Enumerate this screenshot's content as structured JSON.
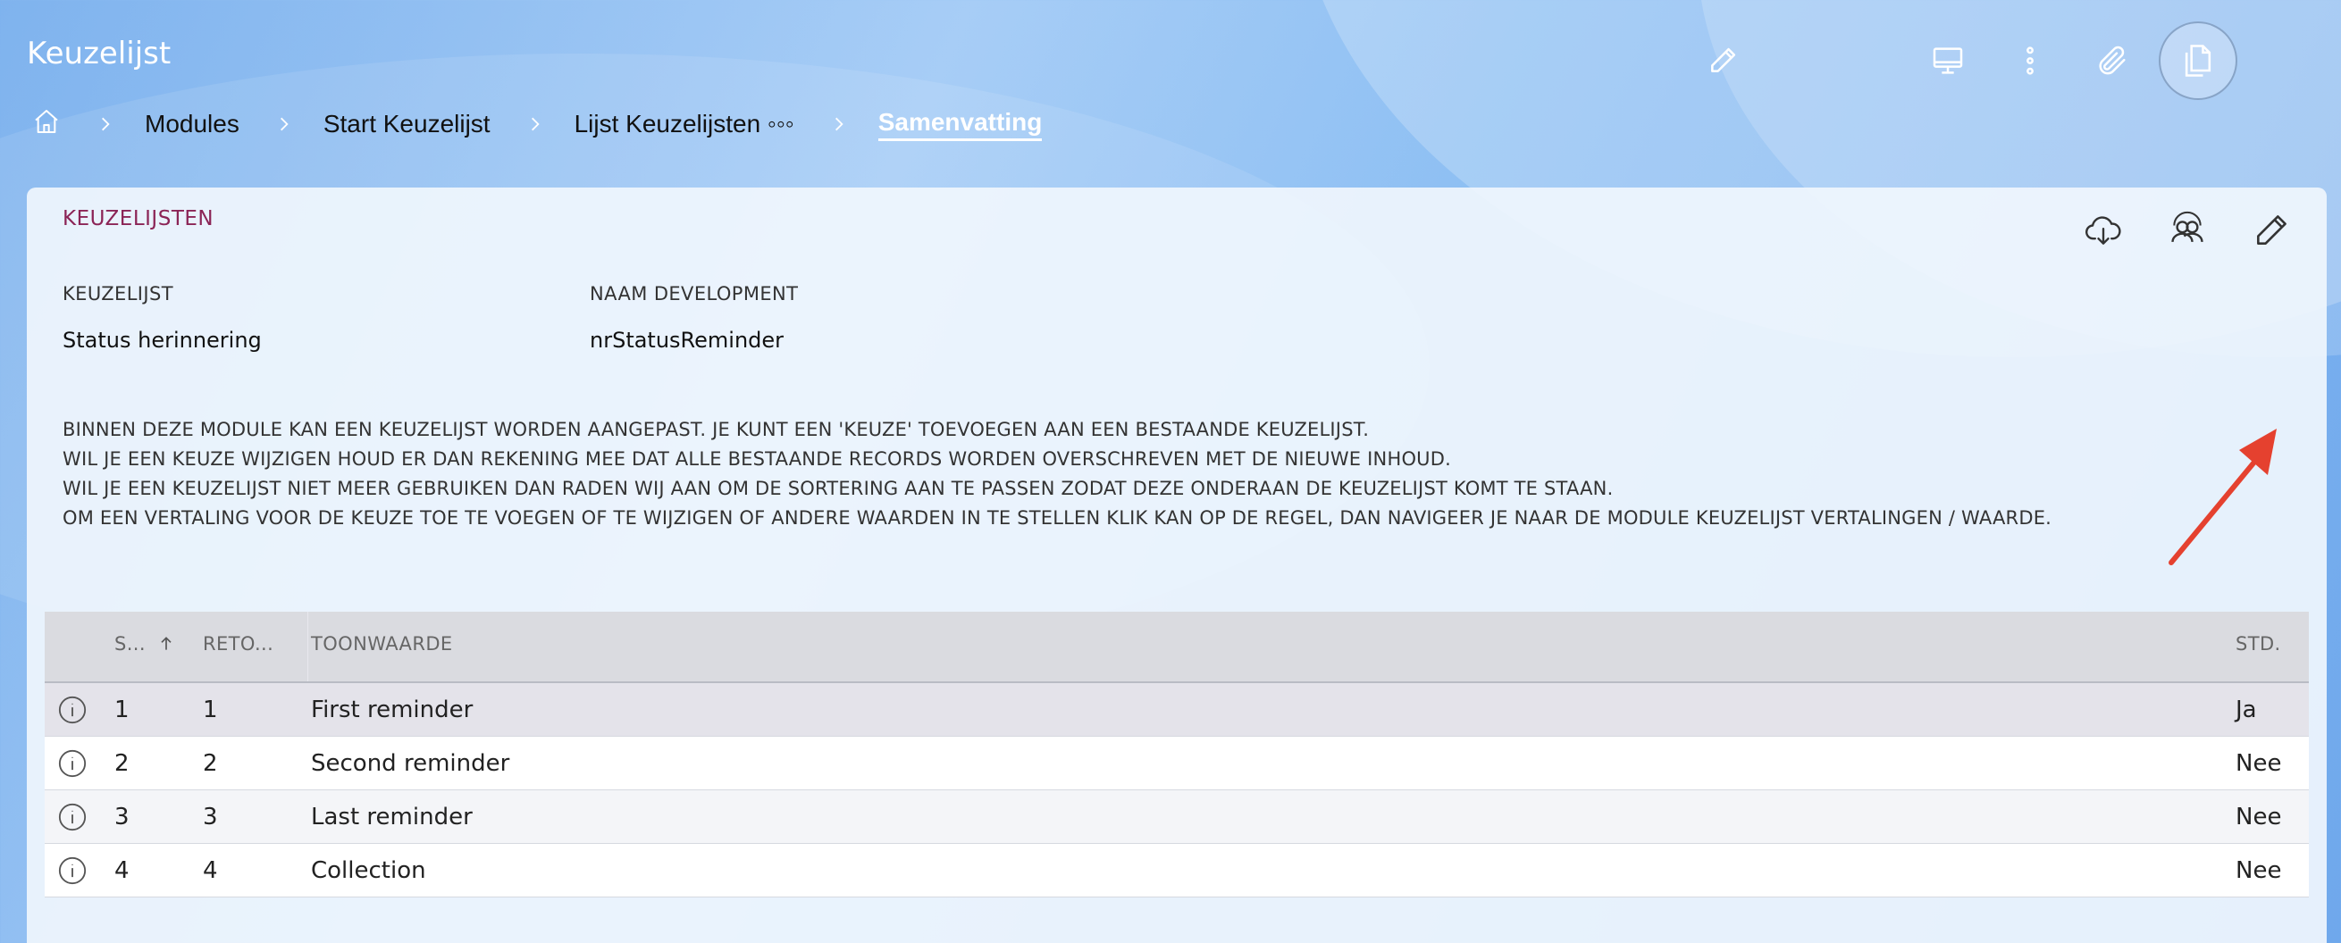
{
  "app": {
    "title": "Keuzelijst"
  },
  "header_icons": [
    "pencil-icon",
    "monitor-icon",
    "more-vertical-icon",
    "paperclip-icon",
    "document-copy-icon"
  ],
  "breadcrumb": {
    "items": [
      "Modules",
      "Start Keuzelijst",
      "Lijst Keuzelijsten ◦◦◦"
    ],
    "current": "Samenvatting"
  },
  "card": {
    "title": "KEUZELIJSTEN",
    "icons": [
      "cloud-download-icon",
      "users-icon",
      "pencil-icon"
    ],
    "fields": [
      {
        "label": "KEUZELIJST",
        "value": "Status herinnering"
      },
      {
        "label": "NAAM DEVELOPMENT",
        "value": "nrStatusReminder"
      }
    ],
    "description": [
      "BINNEN DEZE MODULE KAN EEN KEUZELIJST WORDEN AANGEPAST. JE KUNT EEN 'KEUZE' TOEVOEGEN AAN EEN BESTAANDE KEUZELIJST.",
      "WIL JE EEN KEUZE WIJZIGEN HOUD ER DAN REKENING MEE DAT ALLE BESTAANDE RECORDS WORDEN OVERSCHREVEN MET DE NIEUWE INHOUD.",
      "WIL JE EEN KEUZELIJST NIET MEER GEBRUIKEN DAN RADEN WIJ AAN OM DE SORTERING AAN TE PASSEN ZODAT DEZE ONDERAAN DE KEUZELIJST KOMT TE STAAN.",
      "OM EEN VERTALING VOOR DE KEUZE TOE TE VOEGEN OF TE WIJZIGEN OF ANDERE WAARDEN IN TE STELLEN KLIK KAN OP DE REGEL, DAN NAVIGEER JE NAAR DE MODULE KEUZELIJST VERTALINGEN / WAARDE."
    ]
  },
  "table": {
    "columns": {
      "sort": "S...",
      "return": "RETO...",
      "display": "TOONWAARDE",
      "std": "STD."
    },
    "rows": [
      {
        "sort": "1",
        "return": "1",
        "display": "First reminder",
        "std": "Ja"
      },
      {
        "sort": "2",
        "return": "2",
        "display": "Second reminder",
        "std": "Nee"
      },
      {
        "sort": "3",
        "return": "3",
        "display": "Last reminder",
        "std": "Nee"
      },
      {
        "sort": "4",
        "return": "4",
        "display": "Collection",
        "std": "Nee"
      }
    ]
  },
  "colors": {
    "accent": "#8b2456",
    "annotation_arrow": "#e5412f",
    "background": "#8fc0f3"
  }
}
